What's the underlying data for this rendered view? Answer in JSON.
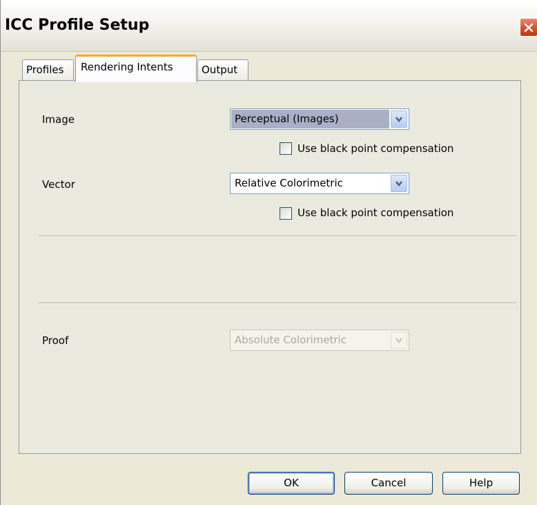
{
  "window": {
    "title": "ICC Profile Setup"
  },
  "tabs": [
    {
      "label": "Profiles",
      "active": false
    },
    {
      "label": "Rendering Intents",
      "active": true
    },
    {
      "label": "Output",
      "active": false
    }
  ],
  "image": {
    "label": "Image",
    "value": "Perceptual (Images)",
    "checkbox_label": "Use black point compensation",
    "checked": false
  },
  "vector": {
    "label": "Vector",
    "value": "Relative Colorimetric",
    "checkbox_label": "Use black point compensation",
    "checked": false
  },
  "proof": {
    "label": "Proof",
    "value": "Absolute Colorimetric",
    "disabled": true
  },
  "buttons": {
    "ok": "OK",
    "cancel": "Cancel",
    "help": "Help"
  },
  "icons": {
    "close": "close-icon",
    "dropdown": "chevron-down-icon"
  },
  "colors": {
    "tab_accent": "#f9a82d",
    "close_button": "#d0502b",
    "button_border": "#003c74"
  }
}
